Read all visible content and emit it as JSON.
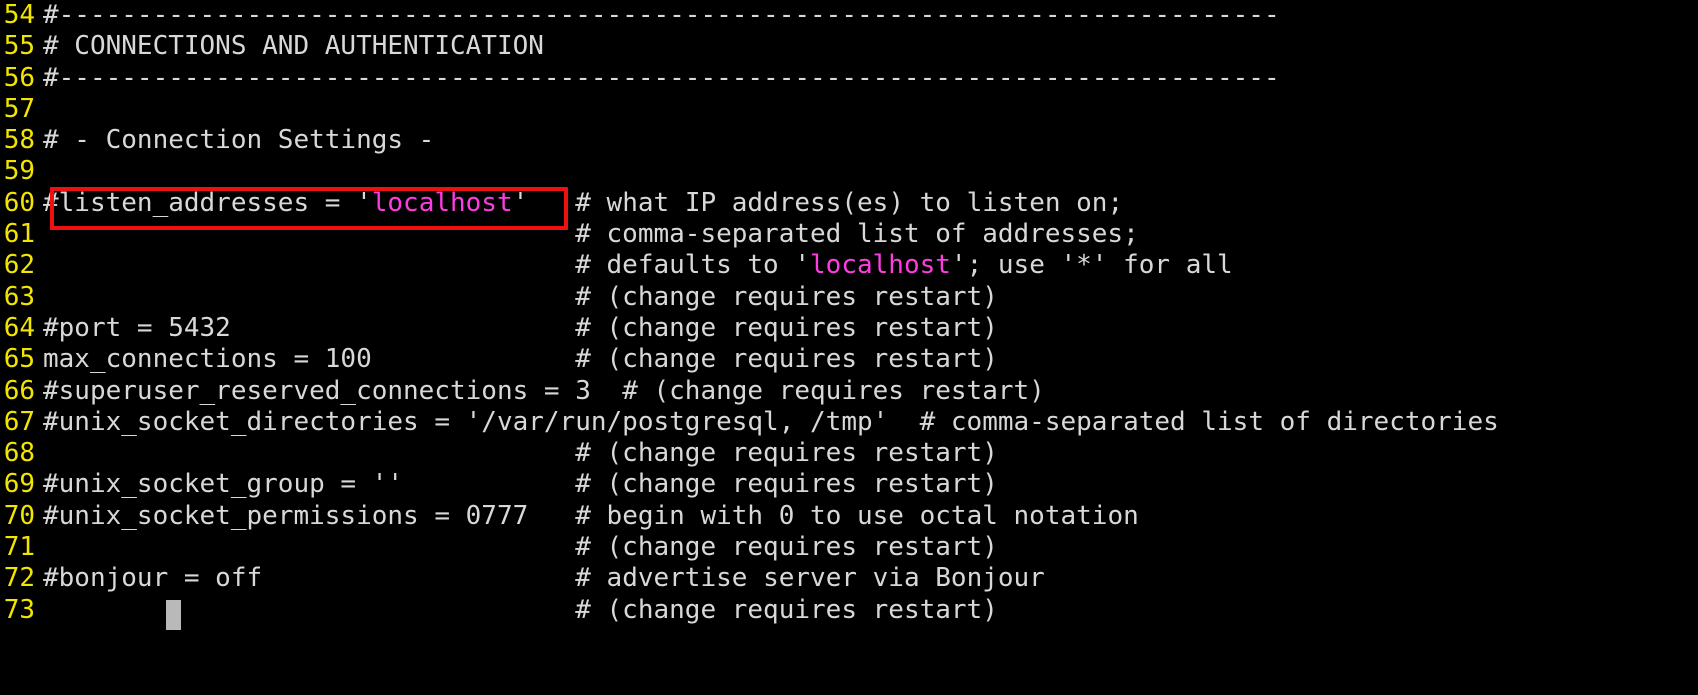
{
  "editor": {
    "app": "terminal-text-editor",
    "file_context": "postgresql.conf",
    "colors": {
      "background": "#000000",
      "line_number": "#f2e500",
      "text": "#d8d8d8",
      "string": "#ff3ce0",
      "annotation_box": "#ee1111",
      "cursor": "#b9b9b9"
    },
    "annotation": {
      "type": "red-rectangle-highlight",
      "target_line": "60",
      "target_text": "#listen_addresses = 'localhost'"
    },
    "cursor": {
      "line": "73",
      "column": "6"
    }
  },
  "lines": [
    {
      "number": "54",
      "code": "#------------------------------------------------------------------------------",
      "comment": ""
    },
    {
      "number": "55",
      "code": "# CONNECTIONS AND AUTHENTICATION",
      "comment": ""
    },
    {
      "number": "56",
      "code": "#------------------------------------------------------------------------------",
      "comment": ""
    },
    {
      "number": "57",
      "code": "",
      "comment": ""
    },
    {
      "number": "58",
      "code": "# - Connection Settings -",
      "comment": ""
    },
    {
      "number": "59",
      "code": "",
      "comment": ""
    },
    {
      "number": "60",
      "code_prefix": "#listen_addresses = ",
      "code_string": "'localhost'",
      "comment": "# what IP address(es) to listen on;"
    },
    {
      "number": "61",
      "code": "",
      "comment": "# comma-separated list of addresses;"
    },
    {
      "number": "62",
      "code": "",
      "comment_prefix": "# defaults to ",
      "comment_string": "'localhost'",
      "comment_suffix": "; use '*' for all"
    },
    {
      "number": "63",
      "code": "",
      "comment": "# (change requires restart)"
    },
    {
      "number": "64",
      "code": "#port = 5432",
      "comment": "# (change requires restart)"
    },
    {
      "number": "65",
      "code": "max_connections = 100",
      "comment": "# (change requires restart)"
    },
    {
      "number": "66",
      "code": "#superuser_reserved_connections = 3",
      "comment": "# (change requires restart)"
    },
    {
      "number": "67",
      "code": "#unix_socket_directories = '/var/run/postgresql, /tmp'",
      "comment": "# comma-separated list of directories"
    },
    {
      "number": "68",
      "code": "",
      "comment": "# (change requires restart)"
    },
    {
      "number": "69",
      "code": "#unix_socket_group = ''",
      "comment": "# (change requires restart)"
    },
    {
      "number": "70",
      "code": "#unix_socket_permissions = 0777",
      "comment": "# begin with 0 to use octal notation"
    },
    {
      "number": "71",
      "code": "",
      "comment": "# (change requires restart)"
    },
    {
      "number": "72",
      "code": "#bonjour = off",
      "comment": "# advertise server via Bonjour"
    },
    {
      "number": "73",
      "code": "",
      "comment": "# (change requires restart)"
    }
  ]
}
